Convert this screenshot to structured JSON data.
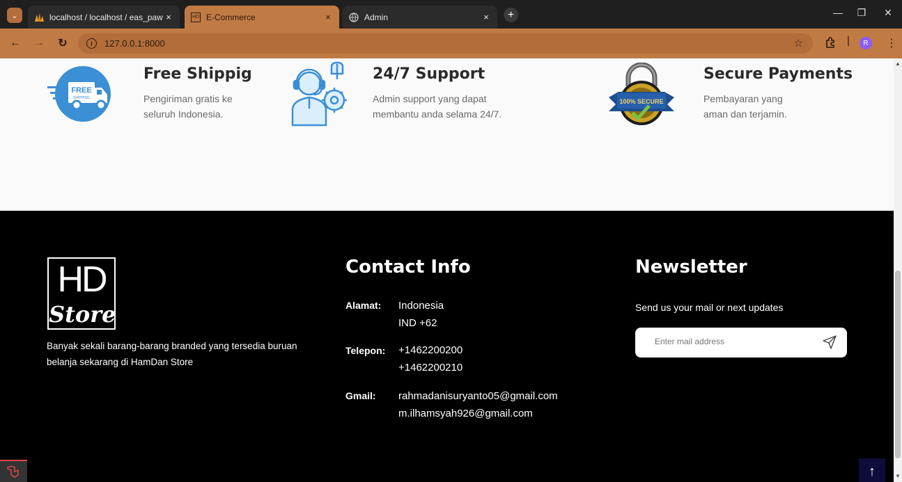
{
  "browser": {
    "tabs": [
      {
        "title": "localhost / localhost / eas_paw",
        "close": "×",
        "favicon": "phpmyadmin-icon"
      },
      {
        "title": "E-Commerce",
        "close": "×",
        "favicon": "hd-store-favicon"
      },
      {
        "title": "Admin",
        "close": "×",
        "favicon": "globe-icon"
      }
    ],
    "new_tab": "+",
    "url": "127.0.0.1:8000",
    "profile_initial": "R",
    "window_controls": {
      "minimize": "—",
      "restore": "❐",
      "close": "✕"
    }
  },
  "features": [
    {
      "title": "Free Shippig",
      "text": "Pengiriman gratis ke seluruh Indonesia.",
      "icon": "free-shipping-truck-icon",
      "badge": "FREE",
      "badge_sub": "SHIPPING"
    },
    {
      "title": "24/7 Support",
      "text": "Admin support yang dapat membantu anda selama 24/7.",
      "icon": "support-agent-gear-icon"
    },
    {
      "title": "Secure Payments",
      "text": "Pembayaran yang aman dan terjamin.",
      "icon": "secure-padlock-icon",
      "badge": "100% SECURE"
    }
  ],
  "footer": {
    "logo": {
      "top": "HD",
      "bottom": "Store"
    },
    "about": "Banyak sekali barang-barang branded yang tersedia buruan belanja sekarang di HamDan Store",
    "contact": {
      "title": "Contact Info",
      "alamat_label": "Alamat:",
      "alamat_values": [
        "Indonesia",
        "IND +62"
      ],
      "telepon_label": "Telepon:",
      "telepon_values": [
        "+1462200200",
        "+1462200210"
      ],
      "gmail_label": "Gmail:",
      "gmail_values": [
        "rahmadanisuryanto05@gmail.com",
        "m.ilhamsyah926@gmail.com"
      ]
    },
    "newsletter": {
      "title": "Newsletter",
      "subtitle": "Send us your mail or next updates",
      "placeholder": "Enter mail address"
    }
  },
  "scroll_top": "↑",
  "colors": {
    "accent": "#c07a44",
    "footer_bg": "#000000",
    "shipping_blue": "#3b8fd4",
    "totop_bg": "#0d0c3a"
  }
}
